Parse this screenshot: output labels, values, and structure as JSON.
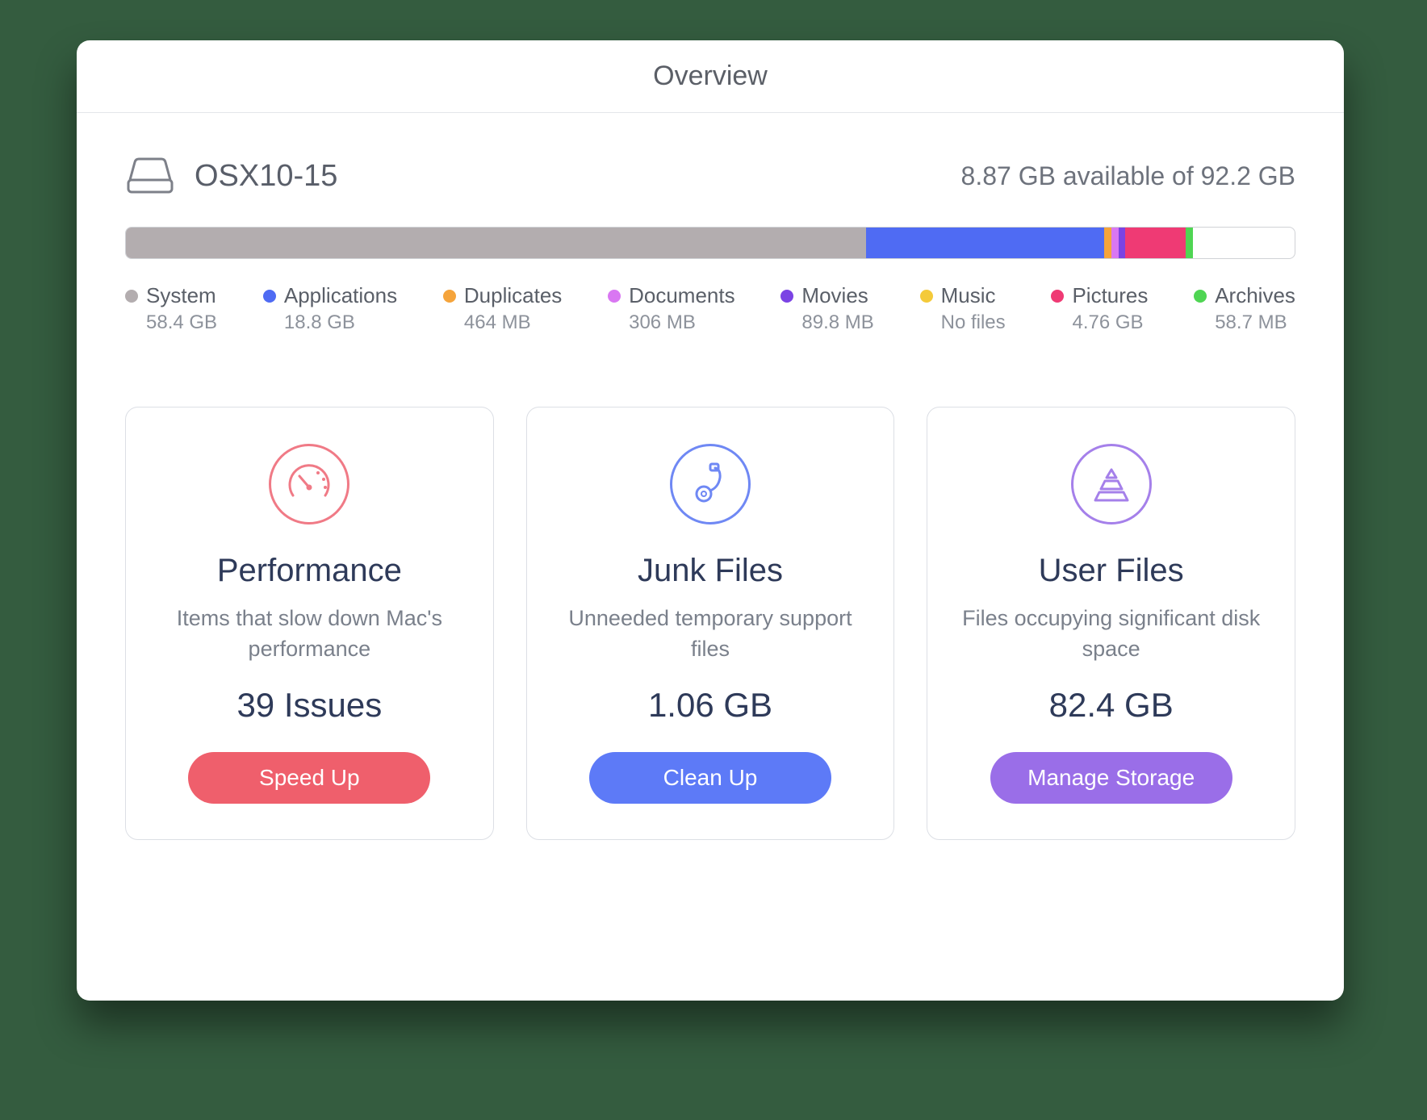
{
  "window": {
    "title": "Overview"
  },
  "disk": {
    "name": "OSX10-15",
    "availability": "8.87 GB available of 92.2 GB"
  },
  "storage": {
    "total_gb": 92.2,
    "segments": [
      {
        "label": "System",
        "size": "58.4 GB",
        "value_gb": 58.4,
        "color": "#b3adaf"
      },
      {
        "label": "Applications",
        "size": "18.8 GB",
        "value_gb": 18.8,
        "color": "#4f6bf3"
      },
      {
        "label": "Duplicates",
        "size": "464 MB",
        "value_gb": 0.464,
        "color": "#f5a43b"
      },
      {
        "label": "Documents",
        "size": "306 MB",
        "value_gb": 0.306,
        "color": "#d977f2"
      },
      {
        "label": "Movies",
        "size": "89.8 MB",
        "value_gb": 0.0898,
        "color": "#7b43e4"
      },
      {
        "label": "Music",
        "size": "No files",
        "value_gb": 0.0,
        "color": "#f4ca3a"
      },
      {
        "label": "Pictures",
        "size": "4.76 GB",
        "value_gb": 4.76,
        "color": "#ef3a74"
      },
      {
        "label": "Archives",
        "size": "58.7 MB",
        "value_gb": 0.0587,
        "color": "#4fd553"
      }
    ],
    "free_gb": 8.87
  },
  "cards": {
    "performance": {
      "title": "Performance",
      "desc": "Items that slow down Mac's performance",
      "metric": "39 Issues",
      "button": "Speed Up"
    },
    "junk": {
      "title": "Junk Files",
      "desc": "Unneeded temporary support files",
      "metric": "1.06 GB",
      "button": "Clean Up"
    },
    "user": {
      "title": "User Files",
      "desc": "Files occupying significant disk space",
      "metric": "82.4 GB",
      "button": "Manage Storage"
    }
  }
}
